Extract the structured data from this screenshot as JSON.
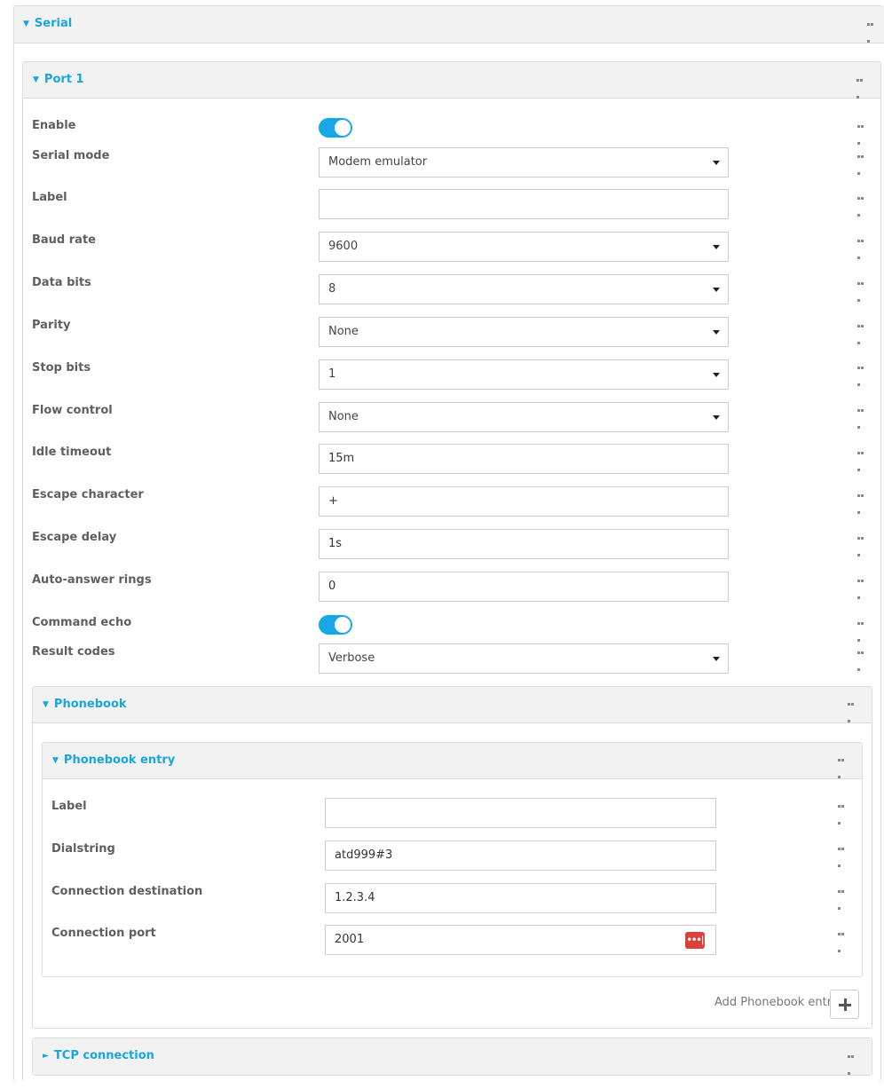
{
  "serial": {
    "title": "Serial",
    "expanded": true
  },
  "port": {
    "title": "Port 1",
    "expanded": true,
    "enable": {
      "label": "Enable",
      "on": true
    },
    "serial_mode": {
      "label": "Serial mode",
      "value": "Modem emulator"
    },
    "label_field": {
      "label": "Label",
      "value": ""
    },
    "baud_rate": {
      "label": "Baud rate",
      "value": "9600"
    },
    "data_bits": {
      "label": "Data bits",
      "value": "8"
    },
    "parity": {
      "label": "Parity",
      "value": "None"
    },
    "stop_bits": {
      "label": "Stop bits",
      "value": "1"
    },
    "flow_control": {
      "label": "Flow control",
      "value": "None"
    },
    "idle_timeout": {
      "label": "Idle timeout",
      "value": "15m"
    },
    "escape_character": {
      "label": "Escape character",
      "value": "+"
    },
    "escape_delay": {
      "label": "Escape delay",
      "value": "1s"
    },
    "auto_answer_rings": {
      "label": "Auto-answer rings",
      "value": "0"
    },
    "command_echo": {
      "label": "Command echo",
      "on": true
    },
    "result_codes": {
      "label": "Result codes",
      "value": "Verbose"
    }
  },
  "phonebook": {
    "title": "Phonebook",
    "entry": {
      "title": "Phonebook entry",
      "label_field": {
        "label": "Label",
        "value": ""
      },
      "dialstring": {
        "label": "Dialstring",
        "value": "atd999#3"
      },
      "connection_destination": {
        "label": "Connection destination",
        "value": "1.2.3.4"
      },
      "connection_port": {
        "label": "Connection port",
        "value": "2001",
        "icon": "password-manager-icon"
      }
    },
    "add_label": "Add Phonebook entry"
  },
  "tcp_connection": {
    "title": "TCP connection",
    "expanded": false
  },
  "icons": {
    "expand_open": "▼",
    "expand_closed": "►",
    "more": "more-options-icon",
    "plus": "plus-icon"
  },
  "colors": {
    "accent": "#19a6dd",
    "toggle_on": "#19a6e5",
    "pw_icon": "#d9413a"
  }
}
